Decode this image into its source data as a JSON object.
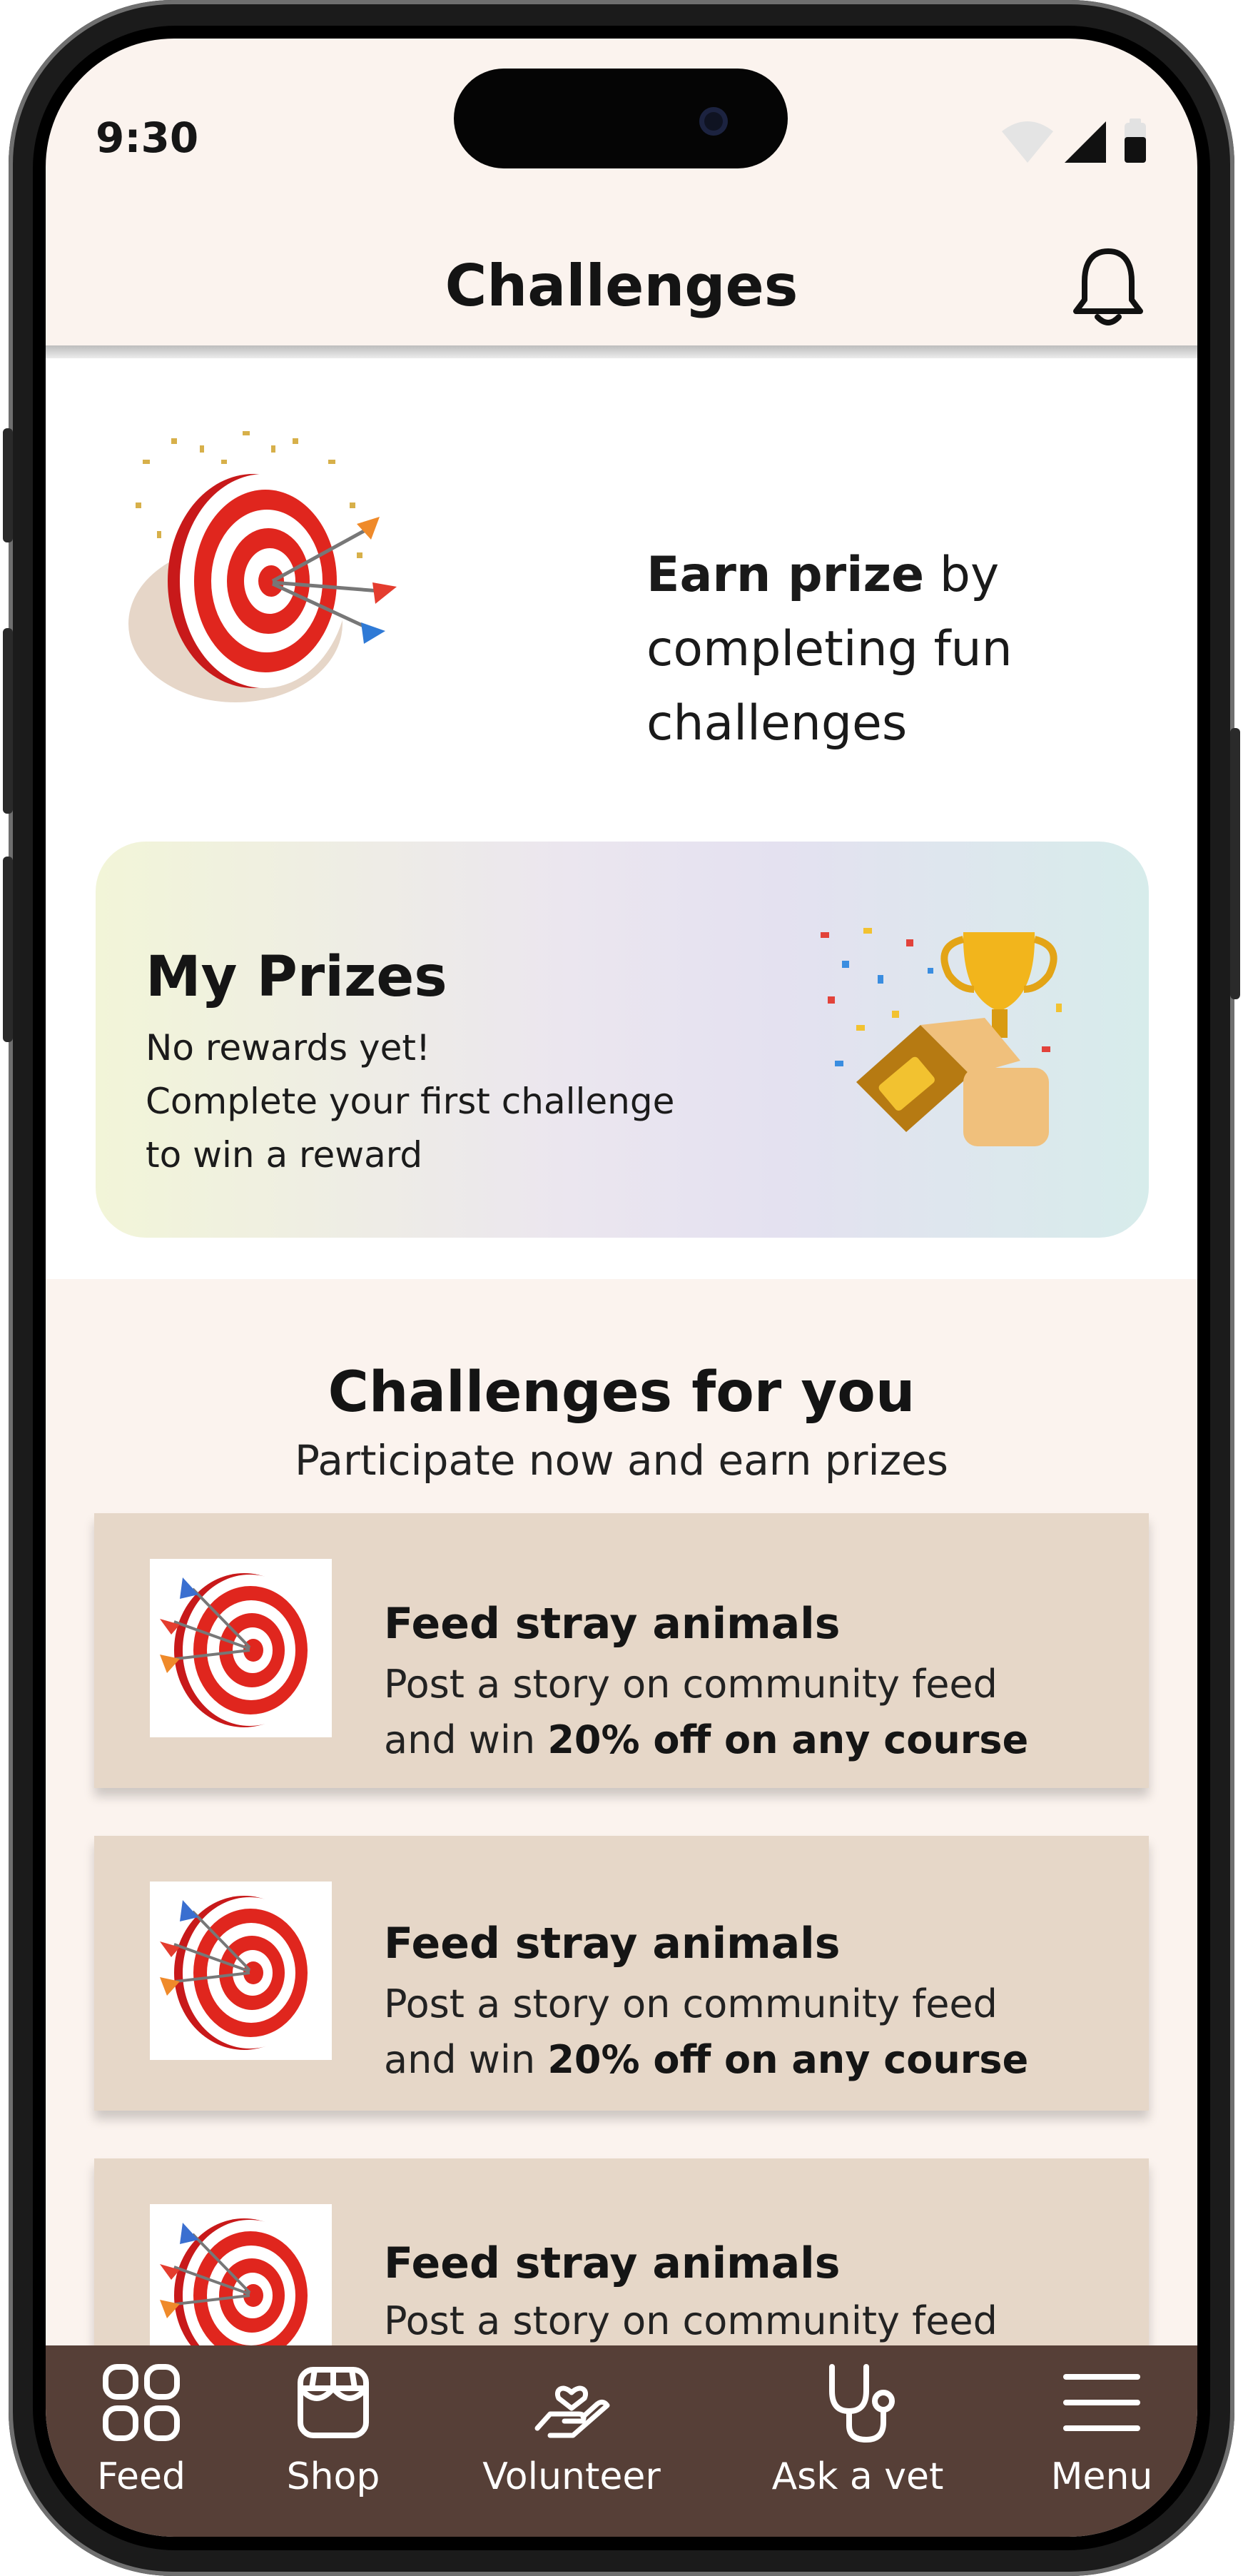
{
  "status": {
    "time": "9:30"
  },
  "header": {
    "title": "Challenges"
  },
  "hero": {
    "bold": "Earn prize",
    "rest_line1": " by",
    "line2": "completing fun",
    "line3": "challenges"
  },
  "prizes": {
    "title": "My Prizes",
    "line1": "No rewards yet!",
    "line2": "Complete your first challenge",
    "line3": "to win a reward"
  },
  "section": {
    "title": "Challenges for you",
    "subtitle": "Participate now and earn prizes"
  },
  "challenges": [
    {
      "title": "Feed stray animals",
      "line1": "Post a story on community feed",
      "line2_prefix": "and win ",
      "line2_bold": "20% off on any course"
    },
    {
      "title": "Feed stray animals",
      "line1": "Post a story on community feed",
      "line2_prefix": "and win ",
      "line2_bold": "20% off on any course"
    },
    {
      "title": "Feed stray animals",
      "line1": "Post a story on community feed"
    }
  ],
  "nav": [
    {
      "label": "Feed",
      "icon": "grid-icon"
    },
    {
      "label": "Shop",
      "icon": "store-icon"
    },
    {
      "label": "Volunteer",
      "icon": "heart-hand-icon"
    },
    {
      "label": "Ask a vet",
      "icon": "stethoscope-icon"
    },
    {
      "label": "Menu",
      "icon": "menu-icon"
    }
  ],
  "colors": {
    "nav_bg": "#563f37",
    "card_bg": "#e6d7c8",
    "screen_bg": "#fbf3ee",
    "target_red": "#e0261e"
  }
}
